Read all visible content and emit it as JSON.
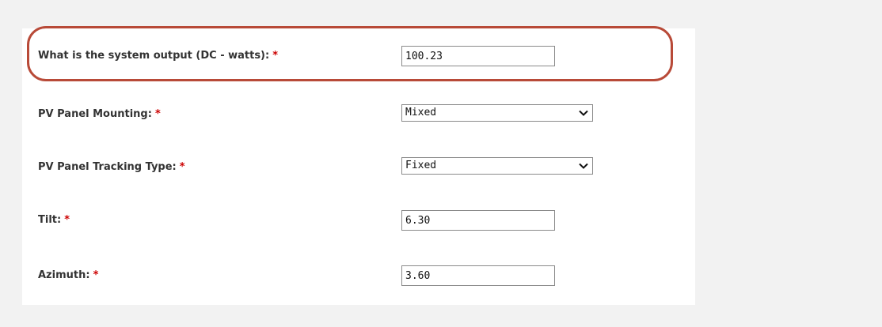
{
  "form": {
    "fields": [
      {
        "label": "What is the system output (DC - watts):",
        "required_mark": "*",
        "type": "text",
        "value": "100.23"
      },
      {
        "label": "PV Panel Mounting:",
        "required_mark": "*",
        "type": "select",
        "value": "Mixed"
      },
      {
        "label": "PV Panel Tracking Type:",
        "required_mark": "*",
        "type": "select",
        "value": "Fixed"
      },
      {
        "label": "Tilt:",
        "required_mark": "*",
        "type": "text",
        "value": "6.30"
      },
      {
        "label": "Azimuth:",
        "required_mark": "*",
        "type": "text",
        "value": "3.60"
      }
    ]
  },
  "colors": {
    "page_background": "#f2f2f2",
    "panel_background": "#ffffff",
    "label_text": "#333333",
    "required_mark": "#cc0000",
    "highlight_ring": "#b84a38"
  },
  "icons": {
    "select_indicator": "chevron-down-icon"
  }
}
